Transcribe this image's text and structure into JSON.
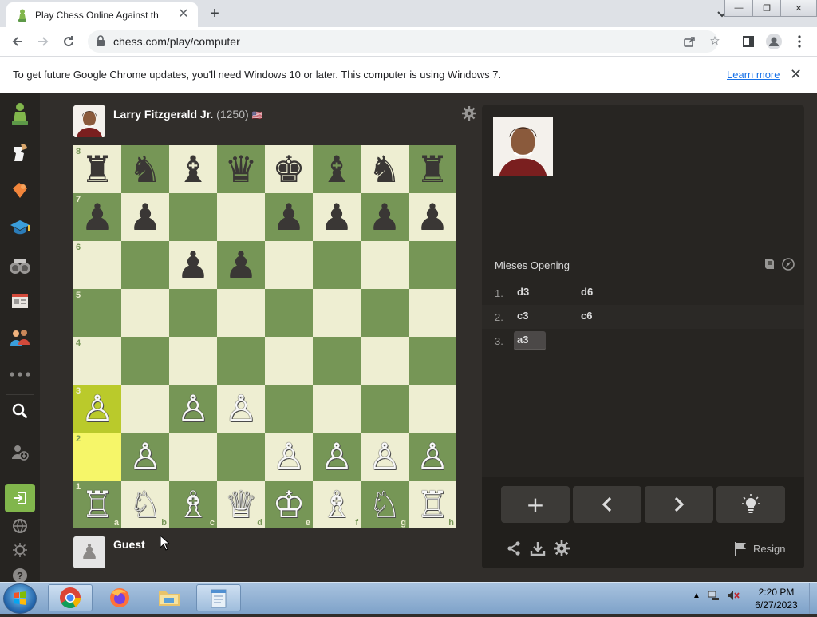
{
  "browser": {
    "tab_title": "Play Chess Online Against th",
    "tab_close": "✕",
    "new_tab": "+",
    "url": "chess.com/play/computer",
    "window_buttons": [
      "—",
      "❐",
      "✕"
    ]
  },
  "infobar": {
    "message": "To get future Google Chrome updates, you'll need Windows 10 or later. This computer is using Windows 7.",
    "link": "Learn more",
    "close": "✕"
  },
  "sidebar": {
    "items": [
      "chess-logo",
      "play",
      "puzzles",
      "learn",
      "watch",
      "news",
      "social",
      "more",
      "search",
      "add-friend",
      "login",
      "language",
      "theme",
      "help"
    ]
  },
  "top_player": {
    "name": "Larry Fitzgerald Jr.",
    "rating": "(1250)",
    "flag": "🇺🇸"
  },
  "bottom_player": {
    "name": "Guest"
  },
  "board": {
    "ranks": [
      [
        "♜",
        "♞",
        "♝",
        "♛",
        "♚",
        "♝",
        "♞",
        "♜"
      ],
      [
        "♟",
        "♟",
        "",
        "",
        "♟",
        "♟",
        "♟",
        "♟"
      ],
      [
        "",
        "",
        "♟",
        "♟",
        "",
        "",
        "",
        ""
      ],
      [
        "",
        "",
        "",
        "",
        "",
        "",
        "",
        ""
      ],
      [
        "",
        "",
        "",
        "",
        "",
        "",
        "",
        ""
      ],
      [
        "♙",
        "",
        "♙",
        "♙",
        "",
        "",
        "",
        ""
      ],
      [
        "",
        "♙",
        "",
        "",
        "♙",
        "♙",
        "♙",
        "♙"
      ],
      [
        "♖",
        "♘",
        "♗",
        "♕",
        "♔",
        "♗",
        "♘",
        "♖"
      ]
    ],
    "colors": [
      [
        "b",
        "b",
        "b",
        "b",
        "b",
        "b",
        "b",
        "b"
      ],
      [
        "b",
        "b",
        "",
        "",
        "b",
        "b",
        "b",
        "b"
      ],
      [
        "",
        "",
        "b",
        "b",
        "",
        "",
        "",
        ""
      ],
      [
        "",
        "",
        "",
        "",
        "",
        "",
        "",
        ""
      ],
      [
        "",
        "",
        "",
        "",
        "",
        "",
        "",
        ""
      ],
      [
        "w",
        "",
        "w",
        "w",
        "",
        "",
        "",
        ""
      ],
      [
        "",
        "w",
        "",
        "",
        "w",
        "w",
        "w",
        "w"
      ],
      [
        "w",
        "w",
        "w",
        "w",
        "w",
        "w",
        "w",
        "w"
      ]
    ],
    "rank_labels": [
      "8",
      "7",
      "6",
      "5",
      "4",
      "3",
      "2",
      "1"
    ],
    "file_labels": [
      "a",
      "b",
      "c",
      "d",
      "e",
      "f",
      "g",
      "h"
    ],
    "highlight": [
      "a3",
      "a2"
    ],
    "colors_hex": {
      "light": "#eeeed2",
      "dark": "#769656",
      "highlight_light": "#f6f669",
      "highlight_dark": "#baca2b"
    }
  },
  "panel": {
    "opening": "Mieses Opening",
    "moves": [
      {
        "num": "1.",
        "white": "d3",
        "black": "d6"
      },
      {
        "num": "2.",
        "white": "c3",
        "black": "c6"
      },
      {
        "num": "3.",
        "white": "a3",
        "black": ""
      }
    ],
    "controls": [
      "+",
      "‹",
      "›",
      "hint"
    ],
    "resign": "Resign"
  },
  "taskbar": {
    "time": "2:20 PM",
    "date": "6/27/2023",
    "apps": [
      "chrome",
      "firefox",
      "explorer",
      "notepad"
    ]
  }
}
